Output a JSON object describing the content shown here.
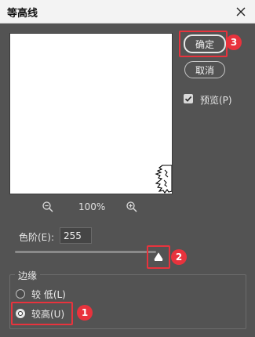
{
  "dialog": {
    "title": "等高线",
    "close_icon": "close-icon"
  },
  "preview_panel": {
    "zoom_out_icon": "zoom-out-icon",
    "zoom_level": "100%",
    "zoom_in_icon": "zoom-in-icon"
  },
  "buttons": {
    "ok_label": "确定",
    "cancel_label": "取消"
  },
  "preview_checkbox": {
    "label": "预览(P)",
    "checked": true
  },
  "level": {
    "label": "色阶(E):",
    "value": "255",
    "slider_fraction": 1.0,
    "slider_range": [
      0,
      255
    ]
  },
  "edge_group": {
    "legend": "边缘",
    "options": [
      {
        "label": "较 低(L)",
        "selected": false
      },
      {
        "label": "较高(U)",
        "selected": true
      }
    ]
  },
  "annotations": {
    "color": "#e8333d",
    "markers": [
      "1",
      "2",
      "3"
    ]
  }
}
